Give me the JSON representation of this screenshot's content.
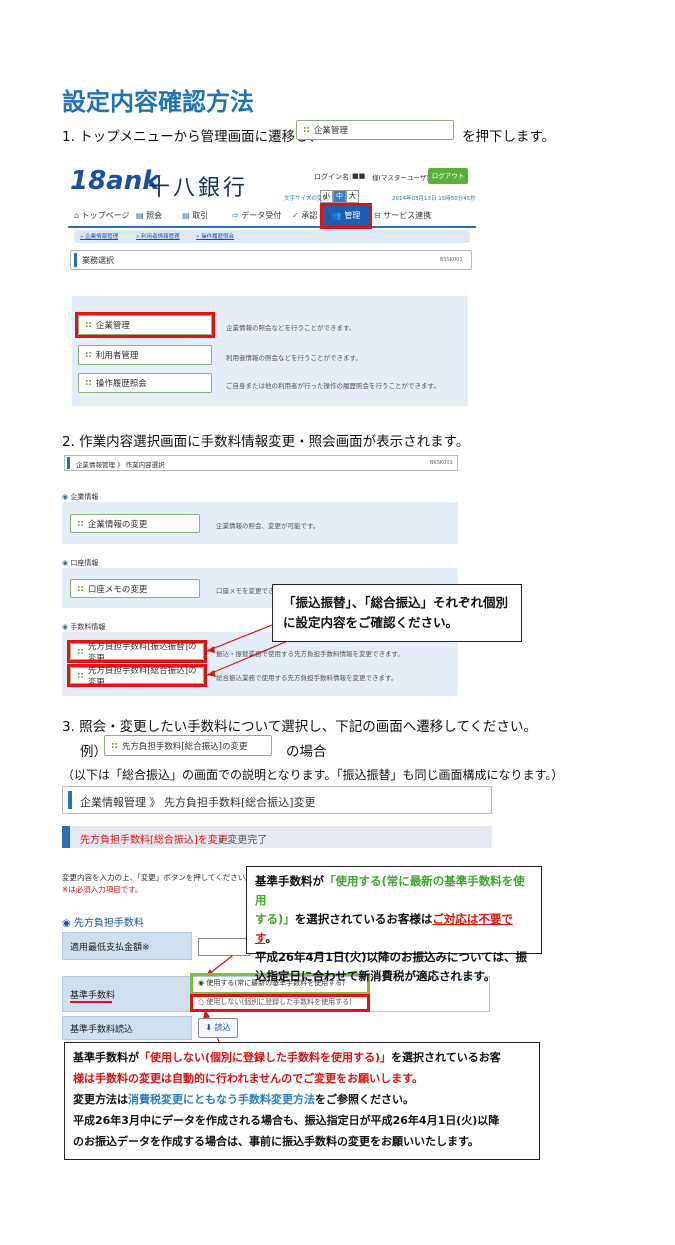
{
  "title": "設定内容確認方法",
  "step1": {
    "prefix": "1. トップメニューから管理画面に遷移し、",
    "button": "企業管理",
    "suffix": "を押下します。"
  },
  "bank": {
    "logo_latin": "18ank",
    "logo_name": "十八銀行",
    "login_label": "ログイン名:",
    "login_user": "■■",
    "login_role": "様(マスターユーザ)",
    "logout": "ログアウト",
    "font_size_label": "文字サイズの変更",
    "font_small": "小",
    "font_mid": "中",
    "font_large": "大",
    "datetime": "2014年03月13日 15時50分45秒",
    "tabs": [
      "トップページ",
      "照会",
      "取引",
      "データ受付",
      "承認",
      "管理",
      "サービス連携"
    ],
    "breadcrumb": [
      "企業情報管理",
      "利用者情報管理",
      "操作履歴照会"
    ],
    "page_heading": "業務選択",
    "page_code": "BSSK001",
    "menu": [
      {
        "label": "企業管理",
        "desc": "企業情報の照会などを行うことができます。"
      },
      {
        "label": "利用者管理",
        "desc": "利用者情報の照会などを行うことができます。"
      },
      {
        "label": "操作履歴照会",
        "desc": "ご自身または他の利用者が行った操作の履歴照会を行うことができます。"
      }
    ]
  },
  "step2": {
    "text": "2. 作業内容選択画面に手数料情報変更・照会画面が表示されます。",
    "heading": "企業情報管理 》 作業内容選択",
    "code": "BKSK001",
    "sections": [
      {
        "title": "企業情報",
        "button": "企業情報の変更",
        "desc": "企業情報の照会、変更が可能です。"
      },
      {
        "title": "口座情報",
        "button": "口座メモの変更",
        "desc": "口座メモを変更できます。"
      }
    ],
    "fee_title": "手数料情報",
    "fee_buttons": [
      {
        "label": "先方負担手数料[振込振替]の変更",
        "desc": "振込・振替業務で使用する先方負担手数料情報を変更できます。"
      },
      {
        "label": "先方負担手数料[総合振込]の変更",
        "desc": "総合振込業務で使用する先方負担手数料情報を変更できます。"
      }
    ],
    "callout": "「振込振替」、「総合振込」それぞれ個別に設定内容をご確認ください。"
  },
  "step3": {
    "text": "3. 照会・変更したい手数料について選択し、下記の画面へ遷移してください。",
    "example_prefix": "例）",
    "example_button": "先方負担手数料[総合振込]の変更",
    "example_suffix": "の場合",
    "note": "（以下は「総合振込」の画面での説明となります。「振込振替」も同じ画面構成になります。）",
    "heading": "企業情報管理 》 先方負担手数料[総合振込]変更",
    "progress_active": "先方負担手数料[総合振込]を変更",
    "progress_next": "変更完了",
    "instruction": "変更内容を入力の上、「変更」ボタンを押してください。",
    "required": "※は必須入力項目です。",
    "section": "先方負担手数料",
    "row1_label": "適用最低支払金額※",
    "row2_label": "基準手数料",
    "radio1": "使用する(常に最新の基準手数料を使用する)",
    "radio2": "使用しない(個別に登録した手数料を使用する)",
    "row3_label": "基準手数料読込",
    "load_button": "読込"
  },
  "callout2": {
    "l1a": "基準手数料が",
    "l1b": "「使用する(常に最新の基準手数料を使用",
    "l2b": "する)」",
    "l2c": "を選択されているお客様は",
    "l2d": "ご対応は不要です",
    "l2e": "。",
    "l3": "平成26年4月1日(火)以降のお振込みについては、振",
    "l4": "込指定日に合わせて新消費税が適応されます。"
  },
  "callout3": {
    "l1a": "基準手数料が",
    "l1b": "「使用しない(個別に登録した手数料を使用する)」",
    "l1c": "を選択されているお客",
    "l2": "様は手数料の変更は自動的に行われませんのでご変更をお願いします。",
    "l3a": "変更方法は",
    "l3b": "消費税変更にともなう手数料変更方法",
    "l3c": "をご参照ください。",
    "l4": "平成26年3月中にデータを作成される場合も、振込指定日が平成26年4月1日(火)以降",
    "l5": "のお振込データを作成する場合は、事前に振込手数料の変更をお願いいたします。"
  }
}
